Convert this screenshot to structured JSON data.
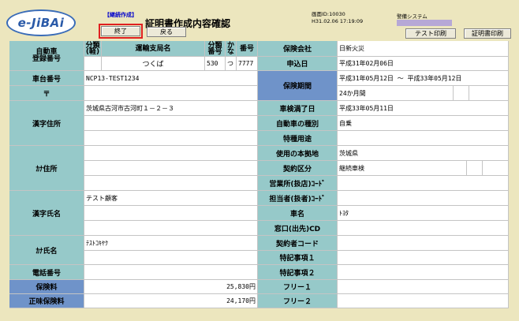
{
  "header": {
    "logo_text": "e-JiBAi",
    "mode_label": "【継続作成】",
    "title": "証明書作成内容確認",
    "screen_id": "画面ID:10030",
    "timestamp": "H31.02.06 17:19:09",
    "system_label": "警備システム"
  },
  "buttons": {
    "end": "終了",
    "back": "戻る",
    "test_print": "テスト印刷",
    "cert_print": "証明書印刷"
  },
  "left": {
    "reg_label": "自動車\n登録番号",
    "hdr_class": "分類\n(軽)",
    "hdr_office": "運輸支局名",
    "hdr_classno": "分類\n番号",
    "hdr_kana": "か\nな",
    "hdr_number": "番号",
    "office": "つくば",
    "classno": "530",
    "kana": "つ",
    "number": "7777",
    "chassis_label": "車台番号",
    "chassis": "NCP13-TEST1234",
    "postal_label": "〒",
    "kanji_addr_label": "漢字住所",
    "kanji_addr": "茨城県古河市古河町１－２－３",
    "kana_addr_label": "ｶﾅ住所",
    "kanji_name_label": "漢字氏名",
    "kanji_name": "テスト顧客",
    "kana_name_label": "ｶﾅ氏名",
    "kana_name": "ﾃｽﾄｺｷﾔｸ",
    "phone_label": "電話番号",
    "premium_label": "保険料",
    "premium": "25,830円",
    "net_premium_label": "正味保険料",
    "net_premium": "24,170円"
  },
  "right": {
    "insurer_label": "保険会社",
    "insurer": "日新火災",
    "apply_date_label": "申込日",
    "apply_date": "平成31年02月06日",
    "period_label": "保険期間",
    "period": "平成31年05月12日 ～ 平成33年05月12日",
    "months": "24か月間",
    "inspection_label": "車検満了日",
    "inspection": "平成33年05月11日",
    "vehicle_type_label": "自動車の種別",
    "vehicle_type": "自乗",
    "special_use_label": "特種用途",
    "base_label": "使用の本拠地",
    "base": "茨城県",
    "contract_type_label": "契約区分",
    "contract_type": "継続車検",
    "branch_code_label": "営業所(扱店)ｺｰﾄﾞ",
    "agent_code_label": "担当者(扱者)ｺｰﾄﾞ",
    "car_name_label": "車名",
    "car_name": "ﾄﾖﾀ",
    "window_label": "窓口(出先)CD",
    "contractor_code_label": "契約者コード",
    "special_note1_label": "特記事項１",
    "special_note2_label": "特記事項２",
    "free1_label": "フリー１",
    "free2_label": "フリー２"
  }
}
